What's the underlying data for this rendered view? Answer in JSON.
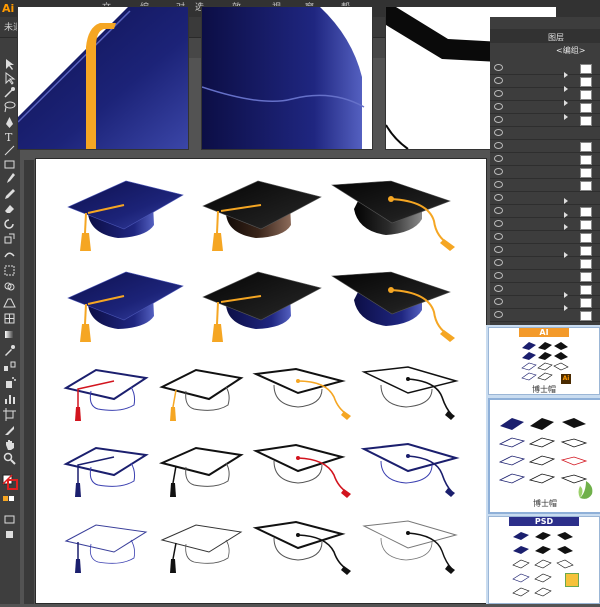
{
  "app": {
    "logo": "Ai",
    "document_tab": "未退",
    "menu_fragments": [
      "文",
      "编",
      "对",
      "选",
      "效",
      "视",
      "窗",
      "帮"
    ]
  },
  "layers_panel": {
    "title": "图层",
    "group_label": "<编组>"
  },
  "thumbnails": [
    {
      "badge": "AI",
      "badge_color": "#f39a2a",
      "caption": "博士帽"
    },
    {
      "badge": "",
      "badge_color": "",
      "caption": "博士帽"
    },
    {
      "badge": "PSD",
      "badge_color": "#2c2f8a",
      "caption": "博士帽"
    }
  ],
  "colors": {
    "navy": "#1b1f6e",
    "navy_light": "#3a3f9a",
    "gold": "#f5a623",
    "red": "#d2141e",
    "black": "#111111"
  },
  "icons": [
    "ai-logo-icon",
    "selection-tool-icon",
    "direct-select-icon",
    "magic-wand-icon",
    "lasso-icon",
    "pen-icon",
    "type-icon",
    "line-icon",
    "rectangle-icon",
    "brush-icon",
    "pencil-icon",
    "eraser-icon",
    "rotate-icon",
    "scale-icon",
    "warp-icon",
    "free-transform-icon",
    "shape-builder-icon",
    "perspective-icon",
    "mesh-icon",
    "gradient-icon",
    "eyedropper-icon",
    "blend-icon",
    "symbol-sprayer-icon",
    "graph-icon",
    "artboard-icon",
    "slice-icon",
    "hand-icon",
    "zoom-icon",
    "fill-stroke-icon",
    "eye-icon",
    "expand-arrow-icon"
  ]
}
